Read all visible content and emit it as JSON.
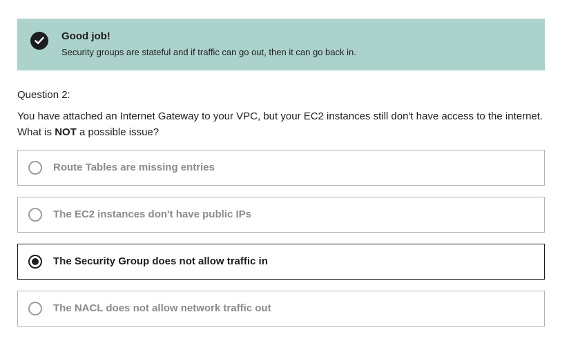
{
  "feedback": {
    "icon": "check-circle-icon",
    "title": "Good job!",
    "message": "Security groups are stateful and if traffic can go out, then it can go back in.",
    "background_color": "#acd2cc"
  },
  "question": {
    "label": "Question 2:",
    "text_before": "You have attached an Internet Gateway to your VPC, but your EC2 instances still don't have access to the internet. What is ",
    "text_emphasis": "NOT",
    "text_after": " a possible issue?"
  },
  "options": [
    {
      "label": "Route Tables are missing entries",
      "selected": false
    },
    {
      "label": "The EC2 instances don't have public IPs",
      "selected": false
    },
    {
      "label": "The Security Group does not allow traffic in",
      "selected": true
    },
    {
      "label": "The NACL does not allow network traffic out",
      "selected": false
    }
  ]
}
